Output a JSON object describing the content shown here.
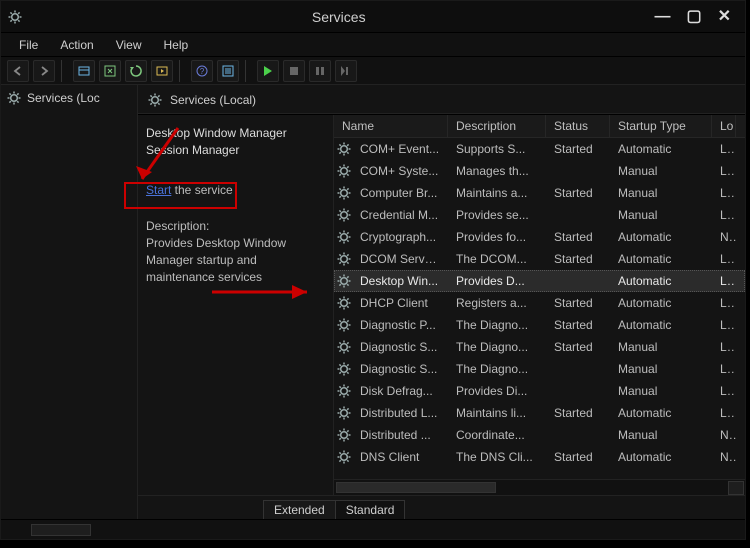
{
  "window": {
    "title": "Services"
  },
  "menubar": {
    "file": "File",
    "action": "Action",
    "view": "View",
    "help": "Help"
  },
  "leftpane": {
    "root": "Services (Loc"
  },
  "rightheader": "Services (Local)",
  "detail": {
    "selected_name": "Desktop Window Manager Session Manager",
    "start_link": "Start",
    "start_suffix": " the service",
    "desc_label": "Description:",
    "desc_text": "Provides Desktop Window Manager startup and maintenance services"
  },
  "columns": {
    "name": "Name",
    "description": "Description",
    "status": "Status",
    "startup": "Startup Type",
    "logon": "Lo"
  },
  "services": [
    {
      "name": "COM+ Event...",
      "desc": "Supports S...",
      "status": "Started",
      "startup": "Automatic",
      "logon": "Lo"
    },
    {
      "name": "COM+ Syste...",
      "desc": "Manages th...",
      "status": "",
      "startup": "Manual",
      "logon": "Lo"
    },
    {
      "name": "Computer Br...",
      "desc": "Maintains a...",
      "status": "Started",
      "startup": "Manual",
      "logon": "Lo"
    },
    {
      "name": "Credential M...",
      "desc": "Provides se...",
      "status": "",
      "startup": "Manual",
      "logon": "Lo"
    },
    {
      "name": "Cryptograph...",
      "desc": "Provides fo...",
      "status": "Started",
      "startup": "Automatic",
      "logon": "Ne"
    },
    {
      "name": "DCOM Serve...",
      "desc": "The DCOM...",
      "status": "Started",
      "startup": "Automatic",
      "logon": "Lo"
    },
    {
      "name": "Desktop Win...",
      "desc": "Provides D...",
      "status": "",
      "startup": "Automatic",
      "logon": "Lo",
      "selected": true
    },
    {
      "name": "DHCP Client",
      "desc": "Registers a...",
      "status": "Started",
      "startup": "Automatic",
      "logon": "Lo"
    },
    {
      "name": "Diagnostic P...",
      "desc": "The Diagno...",
      "status": "Started",
      "startup": "Automatic",
      "logon": "Lo"
    },
    {
      "name": "Diagnostic S...",
      "desc": "The Diagno...",
      "status": "Started",
      "startup": "Manual",
      "logon": "Lo"
    },
    {
      "name": "Diagnostic S...",
      "desc": "The Diagno...",
      "status": "",
      "startup": "Manual",
      "logon": "Lo"
    },
    {
      "name": "Disk Defrag...",
      "desc": "Provides Di...",
      "status": "",
      "startup": "Manual",
      "logon": "Lo"
    },
    {
      "name": "Distributed L...",
      "desc": "Maintains li...",
      "status": "Started",
      "startup": "Automatic",
      "logon": "Lo"
    },
    {
      "name": "Distributed ...",
      "desc": "Coordinate...",
      "status": "",
      "startup": "Manual",
      "logon": "Ne"
    },
    {
      "name": "DNS Client",
      "desc": "The DNS Cli...",
      "status": "Started",
      "startup": "Automatic",
      "logon": "Ne"
    }
  ],
  "tabs": {
    "extended": "Extended",
    "standard": "Standard"
  }
}
